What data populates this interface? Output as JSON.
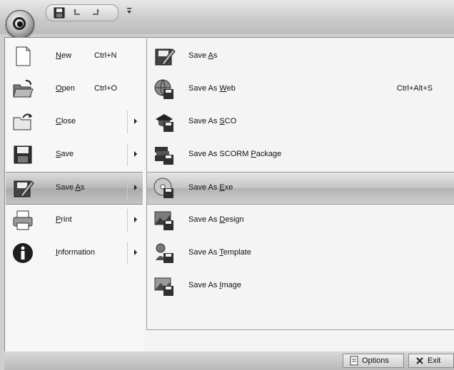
{
  "quick_access": {
    "icons": [
      "save-icon",
      "undo-icon",
      "redo-icon",
      "customize-dropdown-icon"
    ]
  },
  "left_menu": [
    {
      "label": "New",
      "mnemonic": "N",
      "shortcut": "Ctrl+N",
      "icon": "new-document-icon",
      "has_submenu": false
    },
    {
      "label": "Open",
      "mnemonic": "O",
      "shortcut": "Ctrl+O",
      "icon": "open-folder-icon",
      "has_submenu": false
    },
    {
      "label": "Close",
      "mnemonic": "C",
      "shortcut": "",
      "icon": "close-folder-icon",
      "has_submenu": true
    },
    {
      "label": "Save",
      "mnemonic": "S",
      "shortcut": "",
      "icon": "save-floppy-icon",
      "has_submenu": true
    },
    {
      "label": "Save As",
      "mnemonic": "A",
      "shortcut": "",
      "icon": "save-as-icon",
      "has_submenu": true,
      "selected": true
    },
    {
      "label": "Print",
      "mnemonic": "P",
      "shortcut": "",
      "icon": "printer-icon",
      "has_submenu": true
    },
    {
      "label": "Information",
      "mnemonic": "I",
      "shortcut": "",
      "icon": "information-icon",
      "has_submenu": true
    }
  ],
  "right_menu": [
    {
      "label": "Save As",
      "mnemonic": "A",
      "shortcut": "",
      "icon": "save-as-icon"
    },
    {
      "label": "Save As Web",
      "mnemonic": "W",
      "shortcut": "Ctrl+Alt+S",
      "icon": "save-web-icon"
    },
    {
      "label": "Save As SCO",
      "mnemonic": "S",
      "shortcut": "",
      "icon": "save-sco-icon"
    },
    {
      "label": "Save As SCORM Package",
      "mnemonic": "P",
      "shortcut": "",
      "icon": "save-scorm-package-icon"
    },
    {
      "label": "Save As Exe",
      "mnemonic": "E",
      "shortcut": "",
      "icon": "save-exe-icon",
      "selected": true
    },
    {
      "label": "Save As Design",
      "mnemonic": "D",
      "shortcut": "",
      "icon": "save-design-icon"
    },
    {
      "label": "Save As Template",
      "mnemonic": "T",
      "shortcut": "",
      "icon": "save-template-icon"
    },
    {
      "label": "Save As Image",
      "mnemonic": "I",
      "shortcut": "",
      "icon": "save-image-icon"
    }
  ],
  "bottom_bar": {
    "options_label": "Options",
    "exit_label": "Exit"
  }
}
